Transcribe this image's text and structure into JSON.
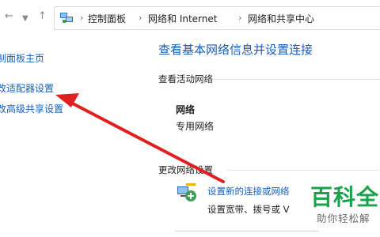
{
  "address_bar": {
    "breadcrumbs": [
      "控制面板",
      "网络和 Internet",
      "网络和共享中心"
    ]
  },
  "left_pane": {
    "links": [
      "制面板主页",
      "改适配器设置",
      "改高级共享设置"
    ]
  },
  "main": {
    "title": "查看基本网络信息并设置连接",
    "active_networks_header": "查看活动网络",
    "network_name": "网络",
    "network_type": "专用网络",
    "change_settings_header": "更改网络设置",
    "setting_link": "设置新的连接或网络",
    "setting_desc": "设置宽带、拨号或 V"
  },
  "watermark": {
    "big": "百科全",
    "small": "助你轻松解"
  },
  "colors": {
    "link": "#1a5fb4",
    "title": "#1d5cb0",
    "arrow": "#e02020",
    "watermark": "#1aa34a"
  }
}
